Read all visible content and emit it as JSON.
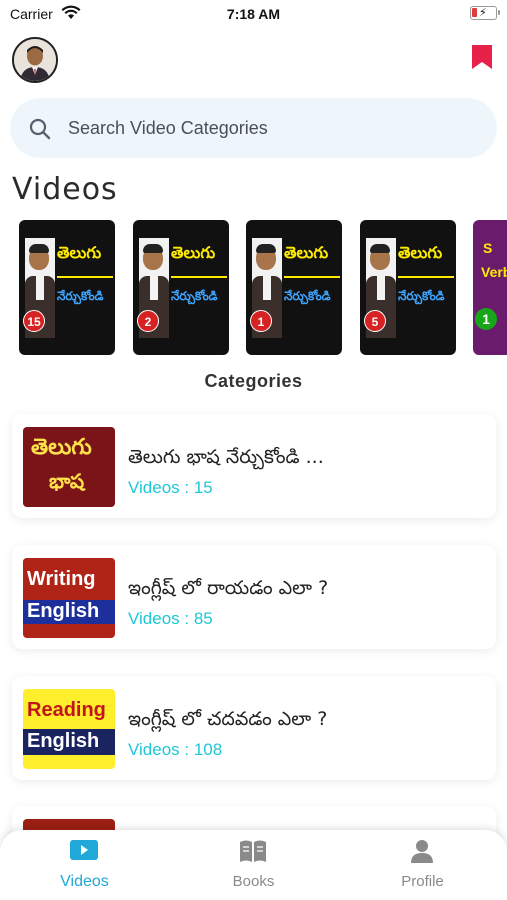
{
  "status_bar": {
    "carrier": "Carrier",
    "time": "7:18 AM"
  },
  "search": {
    "placeholder": "Search Video Categories"
  },
  "section_title": "Videos",
  "videos": [
    {
      "line1": "తెలుగు",
      "line2": "నేర్చుకోండి",
      "number": "15"
    },
    {
      "line1": "తెలుగు",
      "line2": "నేర్చుకోండి",
      "number": "2"
    },
    {
      "line1": "తెలుగు",
      "line2": "నేర్చుకోండి",
      "number": "1"
    },
    {
      "line1": "తెలుగు",
      "line2": "నేర్చుకోండి",
      "number": "5"
    },
    {
      "line1": "S",
      "line2": "Verb",
      "number": "1"
    }
  ],
  "categories_label": "Categories",
  "categories": [
    {
      "title": "తెలుగు భాష నేర్చుకోండి ...",
      "count": "Videos : 15",
      "thumb_line1": "తెలుగు",
      "thumb_line2": "భాష"
    },
    {
      "title": "ఇంగ్లీష్ లో రాయడం ఎలా ?",
      "count": "Videos : 85",
      "thumb_line1": "Writing",
      "thumb_line2": "English"
    },
    {
      "title": "ఇంగ్లీష్ లో చదవడం ఎలా ?",
      "count": "Videos : 108",
      "thumb_line1": "Reading",
      "thumb_line2": "English"
    }
  ],
  "tabs": [
    {
      "label": "Videos",
      "icon": "play-icon",
      "active": true
    },
    {
      "label": "Books",
      "icon": "book-icon",
      "active": false
    },
    {
      "label": "Profile",
      "icon": "person-icon",
      "active": false
    }
  ],
  "colors": {
    "accent": "#20a8d8",
    "count": "#1fc7d6",
    "bookmark": "#e8214b",
    "search_bg": "#eef6fb"
  }
}
